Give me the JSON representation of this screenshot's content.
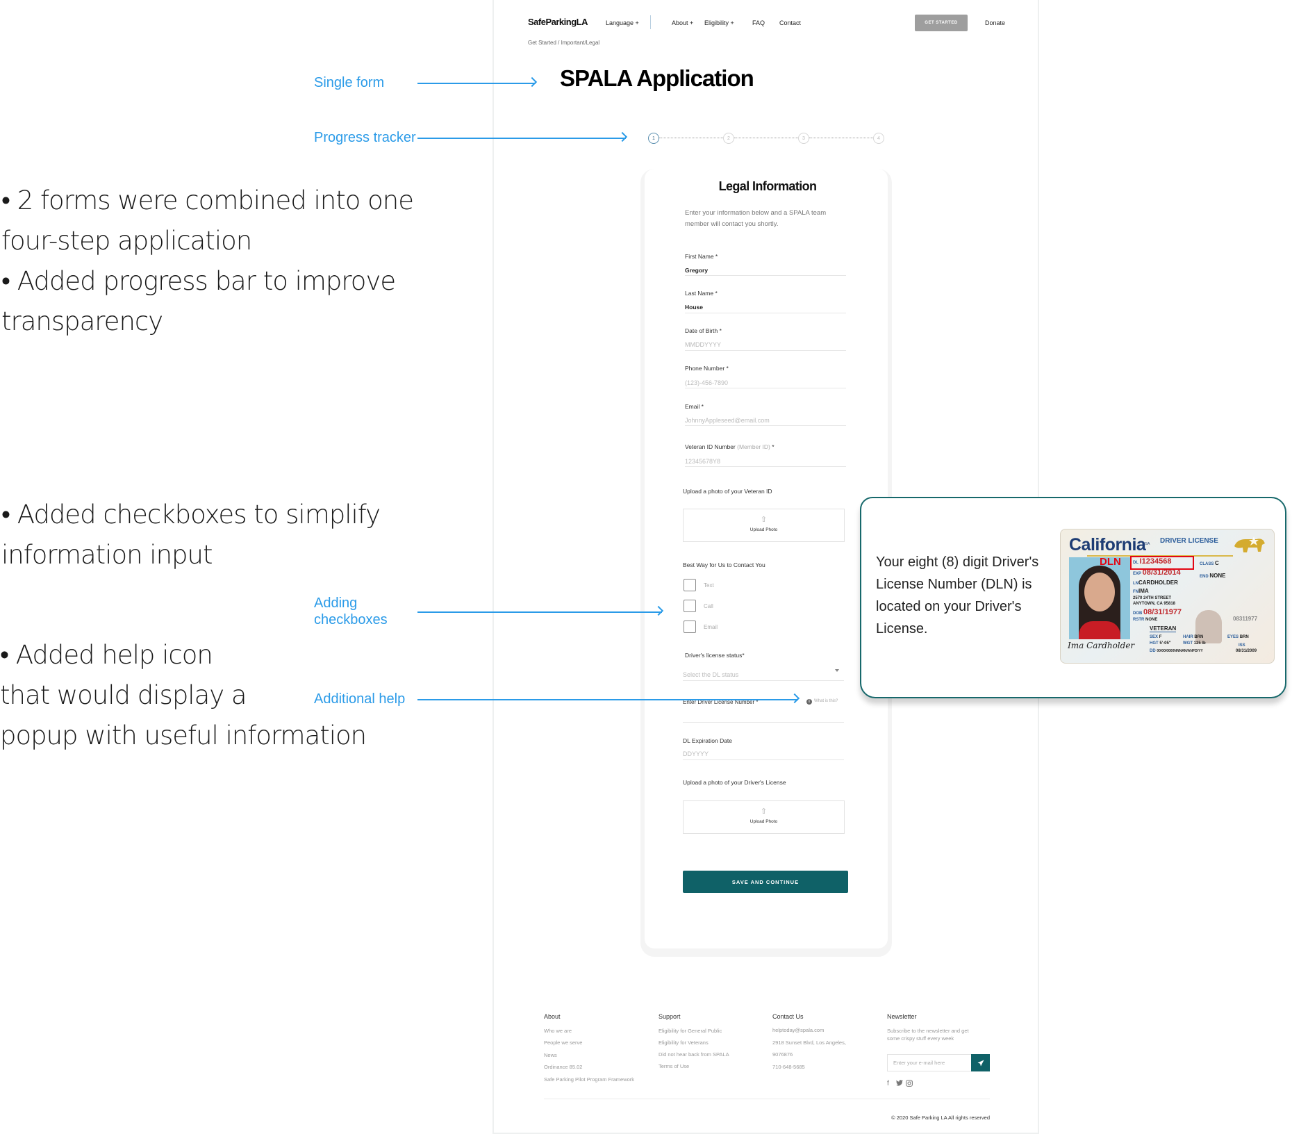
{
  "annotations": {
    "notes": [
      {
        "lines": [
          "• 2 forms were combined into one",
          "four-step application",
          "• Added progress bar to improve",
          "transparency"
        ]
      },
      {
        "lines": [
          "• Added checkboxes to simplify",
          "information input"
        ]
      },
      {
        "lines": [
          "• Added help icon",
          "that would display a",
          "popup with useful information"
        ]
      }
    ],
    "labels": {
      "single_form": "Single form",
      "progress_tracker": "Progress tracker",
      "adding_checkboxes_1": "Adding",
      "adding_checkboxes_2": "checkboxes",
      "additional_help": "Additional help"
    },
    "accent_color": "#2b9be8"
  },
  "header": {
    "logo": "SafeParkingLA",
    "language": "Language +",
    "nav": [
      "About +",
      "Eligibility +",
      "FAQ",
      "Contact"
    ],
    "get_started": "GET STARTED",
    "donate": "Donate"
  },
  "breadcrumb": "Get Started / Important/Legal",
  "page_title": "SPALA Application",
  "progress": {
    "steps": [
      "1",
      "2",
      "3",
      "4"
    ],
    "current_step": 1,
    "total_steps": 4
  },
  "form": {
    "title": "Legal Information",
    "description": "Enter your information below and a SPALA team member will contact you shortly.",
    "fields": {
      "first_name": {
        "label": "First Name *",
        "value": "Gregory"
      },
      "last_name": {
        "label": "Last Name *",
        "value": "House"
      },
      "dob": {
        "label": "Date of Birth *",
        "placeholder": "MMDDYYYY"
      },
      "phone": {
        "label": "Phone Number *",
        "placeholder": "(123)-456-7890"
      },
      "email": {
        "label": "Email *",
        "placeholder": "JohnnyAppleseed@email.com"
      },
      "veteran_id": {
        "label": "Veteran ID Number",
        "label_muted": "(Member ID)",
        "label_suffix": " *",
        "placeholder": "12345678Y8"
      }
    },
    "upload_veteran": {
      "label": "Upload a photo of your Veteran ID",
      "button": "Upload Photo"
    },
    "contact_method": {
      "label": "Best Way for Us to Contact You",
      "options": [
        {
          "label": "Text",
          "checked": false
        },
        {
          "label": "Call",
          "checked": false
        },
        {
          "label": "Email",
          "checked": false
        }
      ]
    },
    "dl_status": {
      "label": "Driver's license status*",
      "placeholder": "Select the DL status"
    },
    "dl_number": {
      "label": "Enter Driver License Number *",
      "help": "What is this?"
    },
    "dl_expiration": {
      "label": "DL Expiration Date",
      "placeholder": "DDYYYY"
    },
    "upload_dl": {
      "label": "Upload a photo of your Driver's License",
      "button": "Upload Photo"
    },
    "submit": "SAVE AND CONTINUE",
    "brand_color": "#0f6167"
  },
  "help_popup": {
    "text": "Your eight (8) digit Driver's License Number (DLN) is located on your Driver's License.",
    "license": {
      "state": "California",
      "usa": "USA",
      "type": "DRIVER LICENSE",
      "dln_tag": "DLN",
      "dl": "I1234568",
      "exp": "08/31/2014",
      "class": "C",
      "end": "NONE",
      "ln": "CARDHOLDER",
      "fn": "IMA",
      "address1": "2570 24TH STREET",
      "address2": "ANYTOWN, CA 95818",
      "dob": "08/31/1977",
      "rstr": "NONE",
      "veteran": "VETERAN",
      "sex": "F",
      "hgt": "5'-05\"",
      "hair": "BRN",
      "wgt": "125 lb",
      "eyes": "BRN",
      "dd": "00/00/0000NNNAN/ANFD/YY",
      "iss": "08/31/2009",
      "side_number": "08311977",
      "signature": "Ima Cardholder"
    }
  },
  "footer": {
    "columns": [
      {
        "heading": "About",
        "items": [
          "Who we are",
          "People we serve",
          "News",
          "Ordinance 85.02",
          "Safe Parking Pilot Program Framework"
        ]
      },
      {
        "heading": "Support",
        "items": [
          "Eligibility for General Public",
          "Eligibility for Veterans",
          "Did not hear back from SPALA",
          "Terms of Use"
        ]
      },
      {
        "heading": "Contact Us",
        "items": [
          "helptoday@spala.com",
          "2918 Sunset Blvd, Los Angeles,",
          "9076876",
          "710-648-5685"
        ]
      }
    ],
    "newsletter": {
      "heading": "Newsletter",
      "text_1": "Subscribe to the newsletter and get",
      "text_2": "some crispy stuff every week",
      "placeholder": "Enter your e-mail here"
    },
    "socials": [
      "facebook-icon",
      "twitter-icon",
      "instagram-icon"
    ],
    "copyright": "© 2020 Safe Parking LA All rights reserved"
  }
}
